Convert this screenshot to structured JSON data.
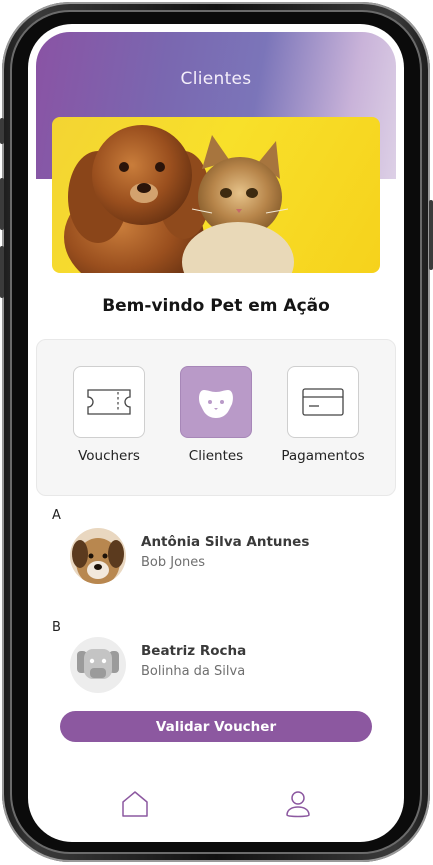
{
  "header": {
    "title": "Clientes"
  },
  "hero": {
    "image_description_icon": "dog-and-cat-photo"
  },
  "welcome": {
    "text": "Bem-vindo Pet em Ação"
  },
  "menu": {
    "items": [
      {
        "label": "Vouchers",
        "icon": "ticket-icon",
        "active": false
      },
      {
        "label": "Clientes",
        "icon": "pet-face-icon",
        "active": true
      },
      {
        "label": "Pagamentos",
        "icon": "credit-card-icon",
        "active": false
      }
    ]
  },
  "clients": {
    "groups": [
      {
        "letter": "A",
        "items": [
          {
            "name": "Antônia Silva Antunes",
            "pet": "Bob Jones",
            "avatar": "dog-photo-avatar"
          }
        ]
      },
      {
        "letter": "B",
        "items": [
          {
            "name": "Beatriz Rocha",
            "pet": "Bolinha da Silva",
            "avatar": "dog-placeholder-avatar"
          }
        ]
      }
    ]
  },
  "actions": {
    "validate_label": "Validar Voucher"
  },
  "bottom_nav": {
    "items": [
      {
        "icon": "home-icon"
      },
      {
        "icon": "user-icon"
      }
    ]
  },
  "colors": {
    "accent": "#8c58a0",
    "active_tile": "#b99ac8",
    "hero_yellow": "#f6d826"
  }
}
